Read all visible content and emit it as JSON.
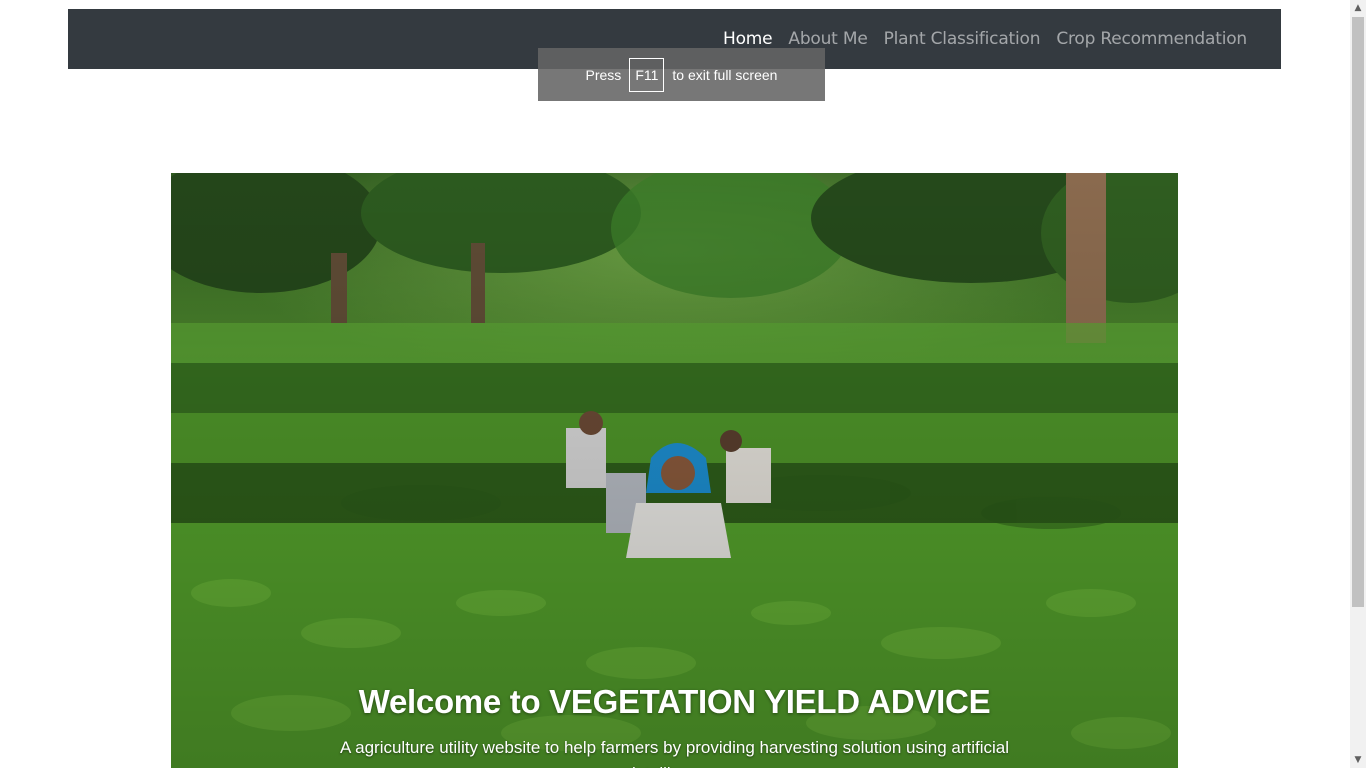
{
  "nav": {
    "items": [
      {
        "label": "Home",
        "active": true
      },
      {
        "label": "About Me",
        "active": false
      },
      {
        "label": "Plant Classification",
        "active": false
      },
      {
        "label": "Crop Recommendation",
        "active": false
      }
    ]
  },
  "fullscreen_notice": {
    "prefix": "Press",
    "key": "F11",
    "suffix": "to exit full screen"
  },
  "hero": {
    "image": "tea-plantation-pickers",
    "title": "Welcome to VEGETATION YIELD ADVICE",
    "subtitle": "A agriculture utility website to help farmers by providing harvesting solution using artificial intelligence"
  },
  "scrollbar": {
    "up_icon": "triangle-up-icon",
    "down_icon": "triangle-down-icon"
  },
  "colors": {
    "navbar_bg": "#343a40",
    "nav_active": "#ffffff",
    "nav_inactive": "rgba(255,255,255,0.55)"
  }
}
